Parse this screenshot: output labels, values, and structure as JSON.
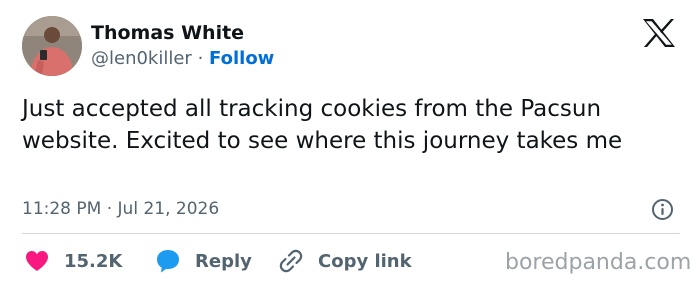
{
  "author": {
    "display_name": "Thomas White",
    "handle": "@len0killer",
    "separator": "·",
    "follow_label": "Follow",
    "avatar_icon": "profile-photo"
  },
  "platform_icon": "x-logo-icon",
  "tweet": {
    "text": "Just accepted all tracking cookies from the Pacsun website. Excited to see where this journey takes me",
    "time": "11:28 PM",
    "separator": "·",
    "date": "Jul 21, 2026"
  },
  "actions": {
    "like": {
      "count": "15.2K",
      "icon": "heart-icon",
      "color": "#f91880"
    },
    "reply": {
      "label": "Reply",
      "icon": "speech-bubble-icon",
      "color": "#1d9bf0"
    },
    "copy": {
      "label": "Copy link",
      "icon": "link-icon"
    }
  },
  "watermark": "boredpanda.com",
  "colors": {
    "text_primary": "#0f1419",
    "text_secondary": "#536471",
    "follow_blue": "#006fd6",
    "divider": "#cfd9de"
  }
}
